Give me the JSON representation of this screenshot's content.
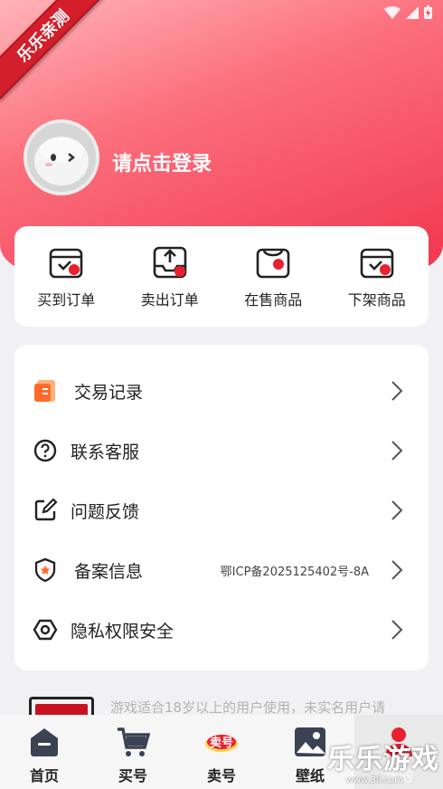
{
  "ribbon": "乐乐亲测",
  "user": {
    "login_prompt": "请点击登录"
  },
  "orders": [
    {
      "label": "买到订单",
      "icon": "bought-orders-icon"
    },
    {
      "label": "卖出订单",
      "icon": "sold-orders-icon"
    },
    {
      "label": "在售商品",
      "icon": "on-sale-icon"
    },
    {
      "label": "下架商品",
      "icon": "off-shelf-icon"
    }
  ],
  "menu": [
    {
      "label": "交易记录",
      "value": "",
      "icon": "transaction-record-icon"
    },
    {
      "label": "联系客服",
      "value": "",
      "icon": "help-circle-icon"
    },
    {
      "label": "问题反馈",
      "value": "",
      "icon": "edit-icon"
    },
    {
      "label": "备案信息",
      "value": "鄂ICP备2025125402号-8A",
      "icon": "shield-icon"
    },
    {
      "label": "隐私权限安全",
      "value": "",
      "icon": "hexagon-icon"
    }
  ],
  "notice": "游戏适合18岁以上的用户使用，未实名用户请",
  "tabs": [
    {
      "label": "首页",
      "icon": "home-icon"
    },
    {
      "label": "买号",
      "icon": "cart-icon"
    },
    {
      "label": "卖号",
      "icon": "sell-badge-icon",
      "badge": "卖号"
    },
    {
      "label": "壁纸",
      "icon": "wallpaper-icon"
    },
    {
      "label": "我的",
      "icon": "profile-icon"
    }
  ],
  "watermark": {
    "main": "乐乐游戏",
    "sub": "www.3ll.com"
  },
  "colors": {
    "accent": "#f1364f",
    "hero_light": "#ffb3b8",
    "card": "#ffffff",
    "background": "#f1f1f3"
  }
}
